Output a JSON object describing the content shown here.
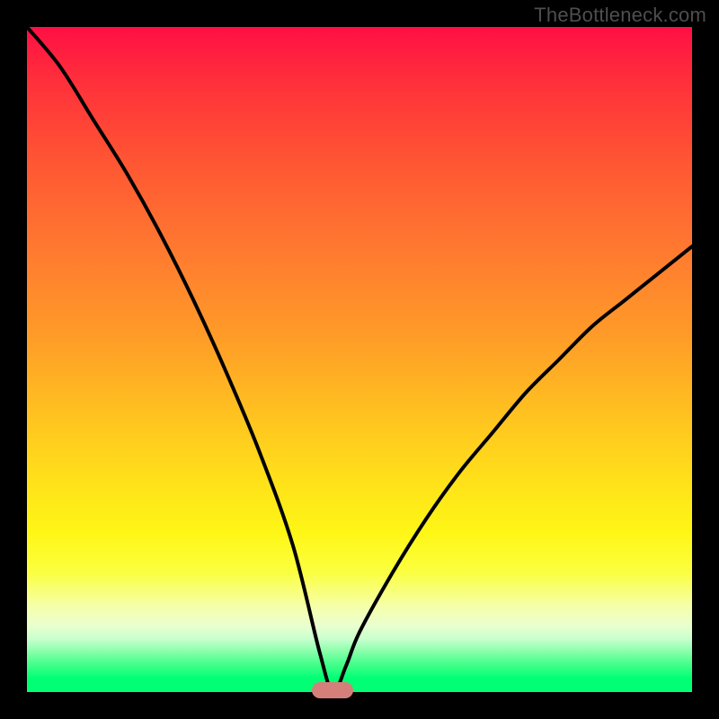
{
  "watermark": "TheBottleneck.com",
  "colors": {
    "background": "#000000",
    "gradient_top": "#ff0f44",
    "gradient_bottom": "#00ff75",
    "curve": "#000000",
    "marker": "#d57f7b"
  },
  "chart_data": {
    "type": "line",
    "title": "",
    "xlabel": "",
    "ylabel": "",
    "xlim": [
      0,
      100
    ],
    "ylim": [
      0,
      100
    ],
    "grid": false,
    "legend": false,
    "annotations": [
      {
        "text": "TheBottleneck.com",
        "position": "top-right"
      }
    ],
    "marker": {
      "x": 46,
      "y": 0,
      "shape": "pill",
      "color": "#d57f7b"
    },
    "series": [
      {
        "name": "bottleneck-curve",
        "x": [
          0,
          5,
          10,
          15,
          20,
          25,
          30,
          35,
          40,
          44,
          46,
          48,
          50,
          55,
          60,
          65,
          70,
          75,
          80,
          85,
          90,
          95,
          100
        ],
        "y": [
          100,
          94,
          86,
          78,
          69,
          59,
          48,
          36,
          22,
          6,
          0,
          4,
          9,
          18,
          26,
          33,
          39,
          45,
          50,
          55,
          59,
          63,
          67
        ]
      }
    ]
  }
}
